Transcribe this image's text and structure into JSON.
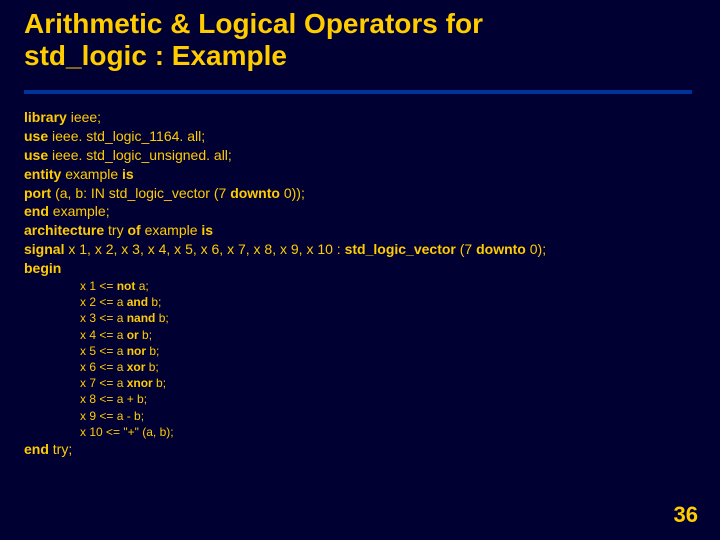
{
  "title_line1": "Arithmetic & Logical Operators for",
  "title_line2": "std_logic : Example",
  "code": {
    "l1": {
      "k1": "library",
      "t1": " ieee;"
    },
    "l2": {
      "k1": "use",
      "t1": " ieee. std_logic_1164. all;"
    },
    "l3": {
      "k1": "use",
      "t1": " ieee. std_logic_unsigned. all;"
    },
    "l4": {
      "k1": "entity",
      "t1": " example ",
      "k2": "is"
    },
    "l5": {
      "k1": "port",
      "t1": " (a, b: IN std_logic_vector (7 ",
      "k2": "downto",
      "t2": " 0));"
    },
    "l6": {
      "k1": "end",
      "t1": " example;"
    },
    "l7": {
      "k1": "architecture",
      "t1": " try ",
      "k2": "of",
      "t2": " example ",
      "k3": "is"
    },
    "l8": {
      "k1": "signal",
      "t1": " x 1, x 2, x 3, x 4, x 5, x 6, x 7, x 8, x 9, x 10 : ",
      "k2": "std_logic_vector",
      "t2": " (7 ",
      "k3": "downto",
      "t3": " 0);"
    },
    "l9": {
      "k1": "begin"
    },
    "s1": {
      "t1": "x 1 <= ",
      "k1": "not",
      "t2": " a;"
    },
    "s2": {
      "t1": "x 2 <= a ",
      "k1": "and",
      "t2": " b;"
    },
    "s3": {
      "t1": "x 3 <= a ",
      "k1": "nand",
      "t2": " b;"
    },
    "s4": {
      "t1": "x 4 <= a ",
      "k1": "or",
      "t2": " b;"
    },
    "s5": {
      "t1": "x 5 <= a ",
      "k1": "nor",
      "t2": " b;"
    },
    "s6": {
      "t1": "x 6 <= a ",
      "k1": "xor",
      "t2": " b;"
    },
    "s7": {
      "t1": "x 7 <= a ",
      "k1": "xnor",
      "t2": " b;"
    },
    "s8": {
      "t1": "x 8 <= a + b;"
    },
    "s9": {
      "t1": "x 9 <= a - b;"
    },
    "s10": {
      "t1": "x 10 <= \"+\" (a, b);"
    },
    "l10": {
      "k1": "end",
      "t1": " try;"
    }
  },
  "page_number": "36"
}
